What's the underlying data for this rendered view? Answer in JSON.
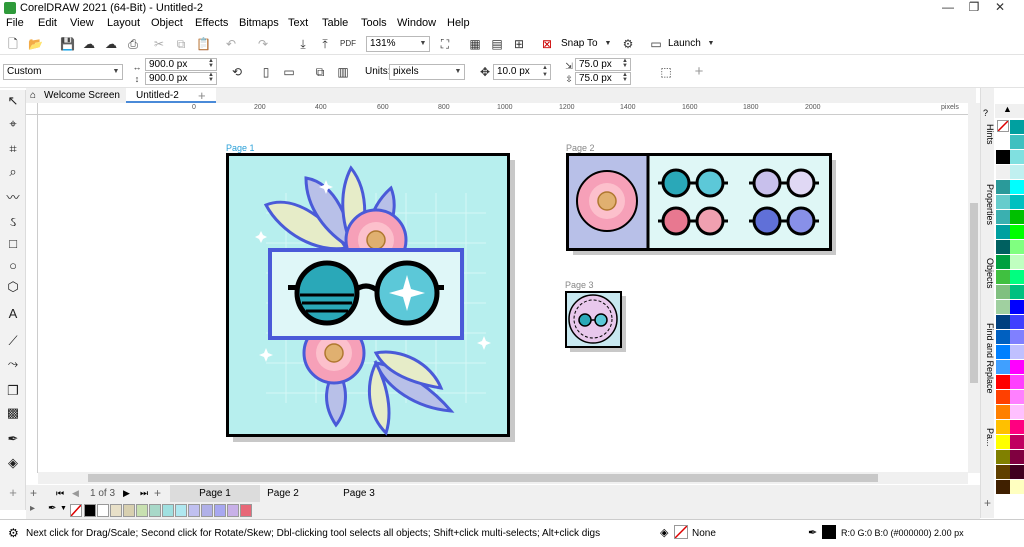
{
  "window": {
    "title": "CorelDRAW 2021 (64-Bit) - Untitled-2",
    "minimize": "—",
    "restore": "❐",
    "close": "✕"
  },
  "menu": [
    "File",
    "Edit",
    "View",
    "Layout",
    "Object",
    "Effects",
    "Bitmaps",
    "Text",
    "Table",
    "Tools",
    "Window",
    "Help"
  ],
  "toolbar": {
    "zoom": "131%",
    "snap_to": "Snap To",
    "launch": "Launch"
  },
  "propertybar": {
    "preset": "Custom",
    "width": "900.0 px",
    "height": "900.0 px",
    "units_label": "Units:",
    "units": "pixels",
    "nudge": "10.0 px",
    "dup_x": "75.0 px",
    "dup_y": "75.0 px"
  },
  "doc_tabs": [
    "Welcome Screen",
    "Untitled-2"
  ],
  "ruler": {
    "unit": "pixels",
    "ticks": [
      "0",
      "200",
      "400",
      "600",
      "800",
      "1000",
      "1200",
      "1400",
      "1600",
      "1800",
      "2000"
    ]
  },
  "pages": {
    "p1": "Page 1",
    "p2": "Page 2",
    "p3": "Page 3"
  },
  "pager": {
    "text": "1 of 3"
  },
  "page_tabs": [
    "Page 1",
    "Page 2",
    "Page 3"
  ],
  "dockers": [
    "Hints",
    "Properties",
    "Objects",
    "Find and Replace",
    "Pa..."
  ],
  "status": {
    "message": "Next click for Drag/Scale; Second click for Rotate/Skew; Dbl-clicking tool selects all objects; Shift+click multi-selects; Alt+click digs",
    "fill": "None",
    "outline": "R:0 G:0 B:0 (#000000)  2.00 px"
  },
  "palette_h": [
    "#000000",
    "#ffffff",
    "#e8e0c8",
    "#d8d0b0",
    "#c8e0b0",
    "#a8d8c8",
    "#a0e0e0",
    "#b0e8f0",
    "#c0c0f0",
    "#b0b0e8",
    "#a8a8f0",
    "#c8b0e8",
    "#e86878"
  ],
  "palette_v1": [
    "#ffffff",
    "#000000",
    "#f0f0f0",
    "#2a9a9a",
    "#66cccc",
    "#3ab0b0",
    "#00a0a0",
    "#006060",
    "#00a040",
    "#40c040",
    "#80c080",
    "#a0d0a0",
    "#004080",
    "#0060c0",
    "#0080ff",
    "#40a0ff",
    "#ff0000",
    "#ff4000",
    "#ff8000",
    "#ffc000",
    "#ffff00",
    "#808000",
    "#604000",
    "#402000",
    "#6060c0",
    "#8080ff",
    "#c0c0ff",
    "#e0e0ff",
    "#8060a0",
    "#604080"
  ],
  "palette_v2": [
    "#00a0a0",
    "#40c0c0",
    "#80e0e0",
    "#c0f0f0",
    "#00ffff",
    "#00c0c0",
    "#00c000",
    "#00ff00",
    "#80ff80",
    "#c0ffc0",
    "#00ff80",
    "#00c080",
    "#0000ff",
    "#4040ff",
    "#8080ff",
    "#c0c0ff",
    "#ff00ff",
    "#ff40ff",
    "#ff80ff",
    "#ffc0ff",
    "#ff0080",
    "#c00060",
    "#800040",
    "#400020",
    "#ffffc0",
    "#ffff80",
    "#e0e0a0",
    "#c0c080",
    "#a0a060",
    "#808040"
  ],
  "colors": {
    "accent": "#4a5ad8",
    "page_bg": "#b7efee",
    "lens_teal": "#2aa8b8"
  }
}
